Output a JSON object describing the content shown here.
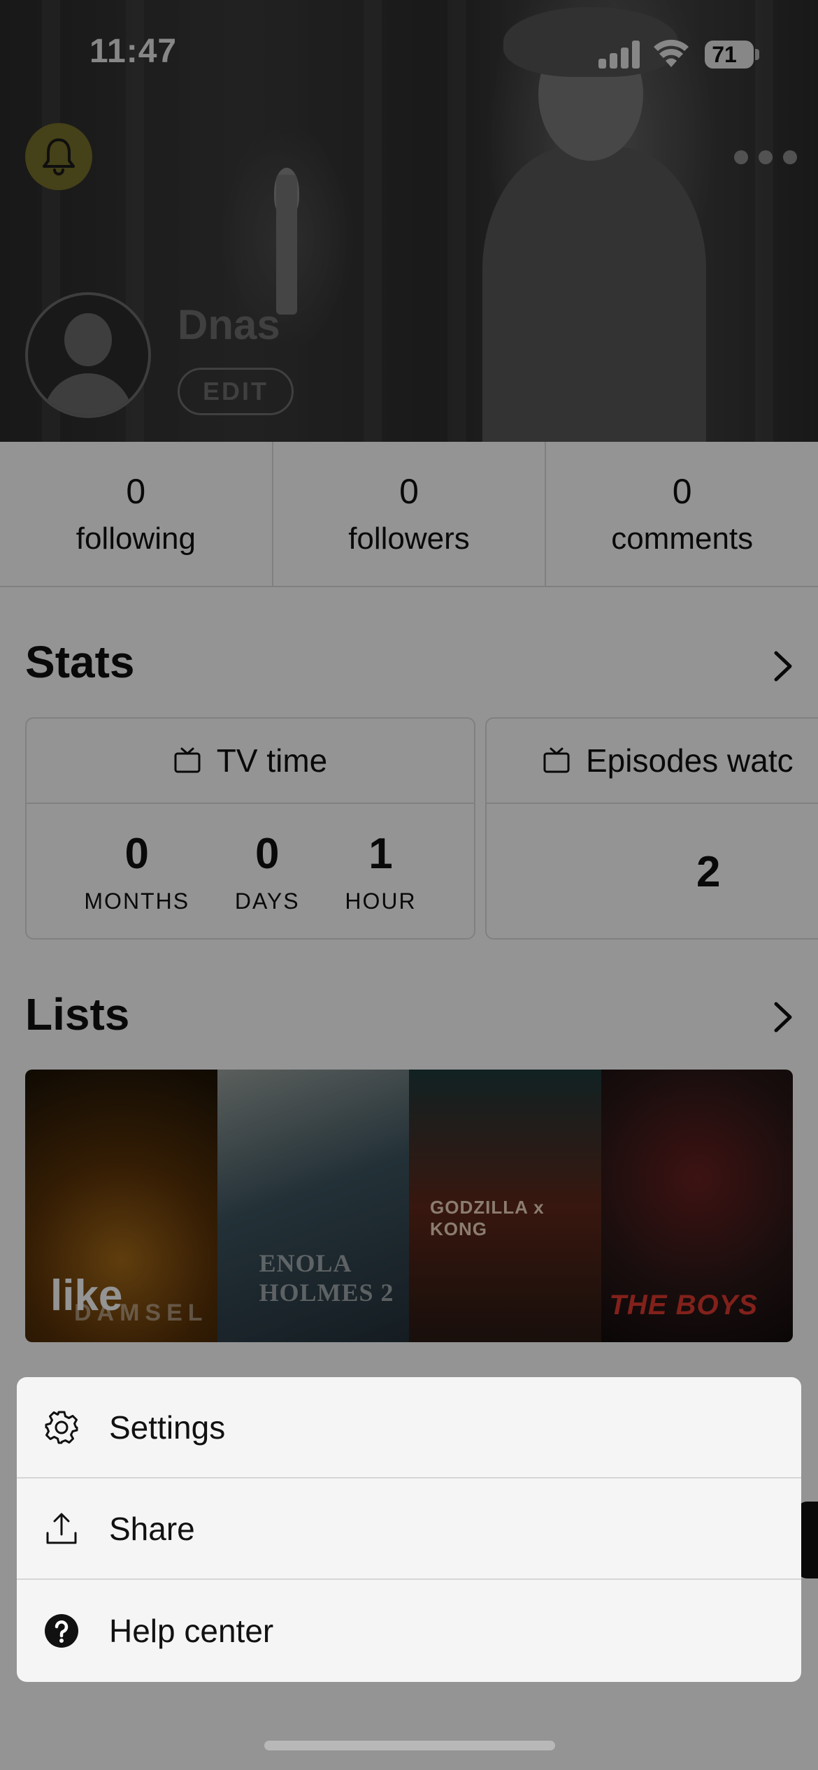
{
  "status_bar": {
    "time": "11:47",
    "battery": "71"
  },
  "profile": {
    "username": "Dnas",
    "edit_label": "EDIT"
  },
  "counts": [
    {
      "value": "0",
      "label": "following"
    },
    {
      "value": "0",
      "label": "followers"
    },
    {
      "value": "0",
      "label": "comments"
    }
  ],
  "stats": {
    "title": "Stats",
    "tv_time": {
      "title": "TV time",
      "months": {
        "value": "0",
        "unit": "MONTHS"
      },
      "days": {
        "value": "0",
        "unit": "DAYS"
      },
      "hours": {
        "value": "1",
        "unit": "HOUR"
      }
    },
    "episodes": {
      "title": "Episodes watc",
      "value": "2"
    }
  },
  "lists": {
    "title": "Lists",
    "first_list_name": "like",
    "posters": [
      {
        "text": "DAMSEL"
      },
      {
        "text": "ENOLA HOLMES 2"
      },
      {
        "text": "GODZILLA x KONG"
      },
      {
        "text": "THE BOYS"
      }
    ]
  },
  "action_sheet": {
    "items": [
      {
        "label": "Settings",
        "icon": "gear-icon"
      },
      {
        "label": "Share",
        "icon": "share-icon"
      },
      {
        "label": "Help center",
        "icon": "help-icon"
      }
    ]
  },
  "colors": {
    "bell_background": "#77702a",
    "scrim": "rgba(0,0,0,0.42)",
    "sheet_background": "#f5f5f5"
  }
}
